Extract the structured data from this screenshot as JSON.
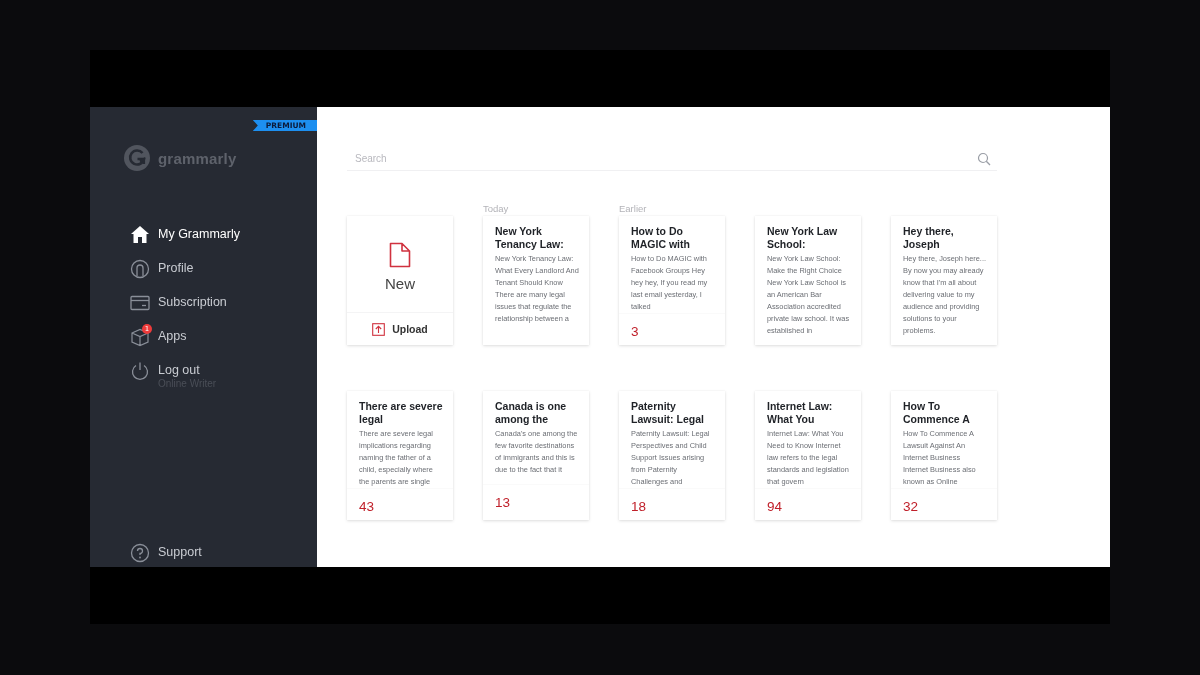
{
  "sidebar": {
    "badge": "PREMIUM",
    "logo": "grammarly",
    "items": [
      {
        "kind": "home",
        "label": "My Grammarly",
        "selected": true
      },
      {
        "kind": "profile",
        "label": "Profile",
        "selected": false
      },
      {
        "kind": "card",
        "label": "Subscription",
        "selected": false
      },
      {
        "kind": "box",
        "label": "Apps",
        "selected": false,
        "count": "1"
      },
      {
        "kind": "power",
        "label": "Log out",
        "selected": false,
        "subtitle": "Online Writer"
      }
    ],
    "footer": {
      "kind": "help",
      "label": "Support"
    }
  },
  "search": {
    "placeholder": "Search"
  },
  "cards": [
    {
      "kind": "new",
      "label": "New",
      "action": "Upload"
    },
    {
      "kind": "doc",
      "section_label": "Today",
      "title": "New York Tenancy Law:",
      "excerpt": "New York Tenancy Law: What Every Landlord And Tenant Should Know There are many legal issues that regulate the relationship between a"
    },
    {
      "kind": "doc",
      "section_label": "Earlier",
      "title": "How to Do MAGIC with",
      "excerpt": "How to Do MAGIC with Facebook Groups Hey hey hey, If you read my last email yesterday, I talked",
      "score": "3"
    },
    {
      "kind": "doc",
      "title": "New York Law School:",
      "excerpt": "New York Law School: Make the Right Choice New York Law School is an American Bar Association accredited private law school. It was established in"
    },
    {
      "kind": "doc",
      "title": "Hey there, Joseph",
      "excerpt": "Hey there, Joseph here... By now you may already know that I'm all about delivering value to my audience and providing solutions to your problems."
    },
    {
      "kind": "doc",
      "title": "There are severe legal",
      "excerpt": "There are severe legal implications regarding naming the father of a child, especially where the parents are single",
      "score": "43"
    },
    {
      "kind": "doc",
      "title": "Canada is one among the",
      "excerpt": "Canada's one among the few favorite destinations of immigrants and this is due to the fact that it",
      "score": "13"
    },
    {
      "kind": "doc",
      "title": "Paternity Lawsuit: Legal",
      "excerpt": "Paternity Lawsuit: Legal Perspectives and Child Support Issues arising from Paternity Challenges and",
      "score": "18"
    },
    {
      "kind": "doc",
      "title": "Internet Law: What You",
      "excerpt": "Internet Law: What You Need to Know Internet law refers to the legal standards and legislation that govern",
      "score": "94"
    },
    {
      "kind": "doc",
      "title": "How To Commence A",
      "excerpt": "How To Commence A Lawsuit Against An Internet Business Internet Business also known as Online",
      "score": "32"
    }
  ]
}
